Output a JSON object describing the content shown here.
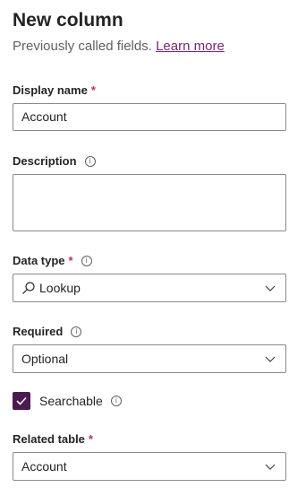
{
  "header": {
    "title": "New column",
    "subtitle": "Previously called fields.",
    "learn_more": "Learn more"
  },
  "display_name": {
    "label": "Display name",
    "required_mark": "*",
    "value": "Account"
  },
  "description": {
    "label": "Description",
    "info_icon": "i",
    "value": ""
  },
  "data_type": {
    "label": "Data type",
    "required_mark": "*",
    "info_icon": "i",
    "value": "Lookup",
    "icon": "search-icon"
  },
  "required": {
    "label": "Required",
    "info_icon": "i",
    "value": "Optional"
  },
  "searchable": {
    "label": "Searchable",
    "info_icon": "i",
    "checked": true
  },
  "related_table": {
    "label": "Related table",
    "required_mark": "*",
    "value": "Account"
  },
  "colors": {
    "accent": "#742774",
    "checkbox": "#4b1a4f",
    "required": "#c4314b"
  }
}
